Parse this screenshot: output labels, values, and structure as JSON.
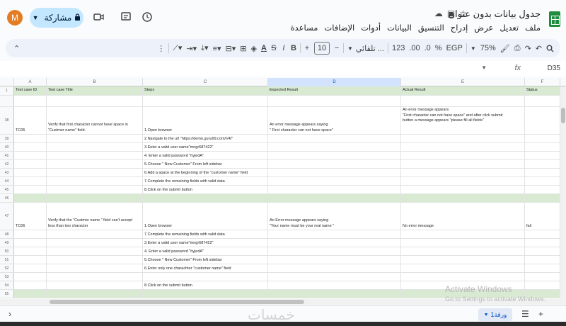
{
  "titlebar": {
    "avatar_initial": "M",
    "share_label": "مشاركة",
    "doc_title": "جدول بيانات بدون عنوان",
    "menu": [
      "ملف",
      "تعديل",
      "عرض",
      "إدراج",
      "التنسيق",
      "البيانات",
      "أدوات",
      "الإضافات",
      "مساعدة"
    ]
  },
  "toolbar": {
    "zoom": "75%",
    "currency": "EGP",
    "percent": "%",
    "dec_decrease": ".0",
    "dec_increase": ".00",
    "number_format": "123",
    "font_name": "تلقائي ...",
    "font_size": "10",
    "bold": "B",
    "italic": "I",
    "text_color": "A"
  },
  "formulabar": {
    "fx": "fx",
    "cell_ref": "D35"
  },
  "columns": [
    "A",
    "B",
    "C",
    "D",
    "E",
    "F"
  ],
  "header_row": {
    "num": "1",
    "cells": [
      "Test case ID",
      "Test case Title",
      "Steps",
      "Expected Result",
      "Actual Result",
      "Status"
    ]
  },
  "rows": [
    {
      "num": "38",
      "cells": [
        "TC05",
        "Verify that first character cannot have space in \"Custmer name\" field.",
        "1.Open browser",
        "An error message appears saying\n \" First character can not have space\"",
        "An error message appears\n\"First character can not have space\"  and after click submit\nbutton a message appears \"please fill all fields\"",
        ""
      ]
    },
    {
      "num": "39",
      "cells": [
        "",
        "",
        "2.Navigate to the url \"https://demo.guru99.com/V4/\"",
        "",
        "",
        ""
      ]
    },
    {
      "num": "40",
      "cells": [
        "",
        "",
        "3.Enter a valid user name\"mngr687422\"",
        "",
        "",
        ""
      ]
    },
    {
      "num": "41",
      "cells": [
        "",
        "",
        "4. Enter a valid password \"hyjedA\"",
        "",
        "",
        ""
      ]
    },
    {
      "num": "42",
      "cells": [
        "",
        "",
        "5.Choose \" New Customer\" From left sidebar",
        "",
        "",
        ""
      ]
    },
    {
      "num": "43",
      "cells": [
        "",
        "",
        "6.Add a space at the beginning of the \"customer name\" field",
        "",
        "",
        ""
      ]
    },
    {
      "num": "44",
      "cells": [
        "",
        "",
        "7.Complete the remaining fields with valid data",
        "",
        "",
        ""
      ]
    },
    {
      "num": "45",
      "cells": [
        "",
        "",
        "8.Click on the submit button",
        "",
        "",
        ""
      ]
    },
    {
      "num": "46",
      "cells": [
        "",
        "",
        "",
        "",
        "",
        ""
      ]
    },
    {
      "num": "47",
      "cells": [
        "TC06",
        "Verify that the \"Custmer name \" field can't accept\n less than two character",
        "1.Open browser",
        "An Error message appears saying\n\"Your name must be your real name \"",
        "No error message",
        "fail"
      ]
    },
    {
      "num": "48",
      "cells": [
        "",
        "",
        "7.Complete the remaining fields with valid data",
        "",
        "",
        ""
      ]
    },
    {
      "num": "49",
      "cells": [
        "",
        "",
        "3.Enter a valid user name\"mngr687422\"",
        "",
        "",
        ""
      ]
    },
    {
      "num": "50",
      "cells": [
        "",
        "",
        "4. Enter a valid password \"hyjedA\"",
        "",
        "",
        ""
      ]
    },
    {
      "num": "51",
      "cells": [
        "",
        "",
        "5.Choose \" New Customer\" From left sidebar",
        "",
        "",
        ""
      ]
    },
    {
      "num": "52",
      "cells": [
        "",
        "",
        "6.Enter only one charachter \"customer name\" field",
        "",
        "",
        ""
      ]
    },
    {
      "num": "53",
      "cells": [
        "",
        "",
        "",
        "",
        "",
        ""
      ]
    },
    {
      "num": "54",
      "cells": [
        "",
        "",
        "8.Click on the submit button",
        "",
        "",
        ""
      ]
    },
    {
      "num": "55",
      "cells": [
        "",
        "",
        "",
        "",
        "",
        ""
      ]
    }
  ],
  "watermark": {
    "line1": "Activate Windows",
    "line2": "Go to Settings to activate Windows."
  },
  "bottombar": {
    "sheet_name": "ورقة1",
    "site_watermark": "خمسات"
  },
  "colors": {
    "header_green": "#d9ead3",
    "selected_col": "#d3e3fd",
    "share_bg": "#c2e7ff",
    "sheets_green": "#1e8e3e"
  }
}
